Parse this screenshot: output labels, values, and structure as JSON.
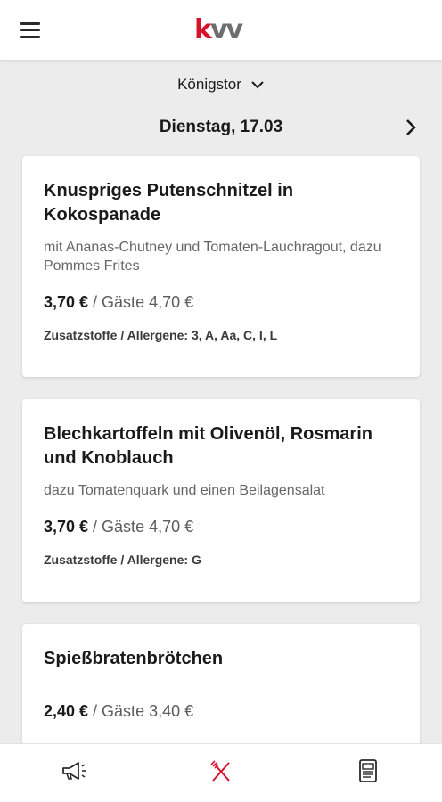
{
  "header": {
    "logo_k": "k",
    "logo_vv": "vv",
    "menu_icon": "hamburger-menu-icon"
  },
  "location": {
    "name": "Königstor",
    "icon": "chevron-down-icon"
  },
  "date": {
    "label": "Dienstag, 17.03",
    "next_icon": "chevron-right-icon"
  },
  "meals": [
    {
      "title": "Knuspriges Putenschnitzel in Kokospanade",
      "description": "mit Ananas-Chutney und Tomaten-Lauchragout, dazu Pommes Frites",
      "price": "3,70 €",
      "guest_price": " / Gäste 4,70 €",
      "allergens": "Zusatzstoffe / Allergene: 3, A, Aa, C, I, L"
    },
    {
      "title": "Blechkartoffeln mit Olivenöl, Rosmarin und Knoblauch",
      "description": "dazu Tomatenquark und einen Beilagensalat",
      "price": "3,70 €",
      "guest_price": " / Gäste 4,70 €",
      "allergens": "Zusatzstoffe / Allergene: G"
    },
    {
      "title": "Spießbratenbrötchen",
      "description": "",
      "price": "2,40 €",
      "guest_price": " / Gäste 3,40 €",
      "allergens": ""
    }
  ],
  "bottom_nav": {
    "items": [
      {
        "icon": "megaphone-icon",
        "active": false
      },
      {
        "icon": "fork-knife-icon",
        "active": true
      },
      {
        "icon": "newspaper-icon",
        "active": false
      }
    ]
  },
  "colors": {
    "brand_red": "#d4122c",
    "logo_gray": "#6e6e6e",
    "background": "#ececec",
    "text": "#1a1a1a"
  }
}
